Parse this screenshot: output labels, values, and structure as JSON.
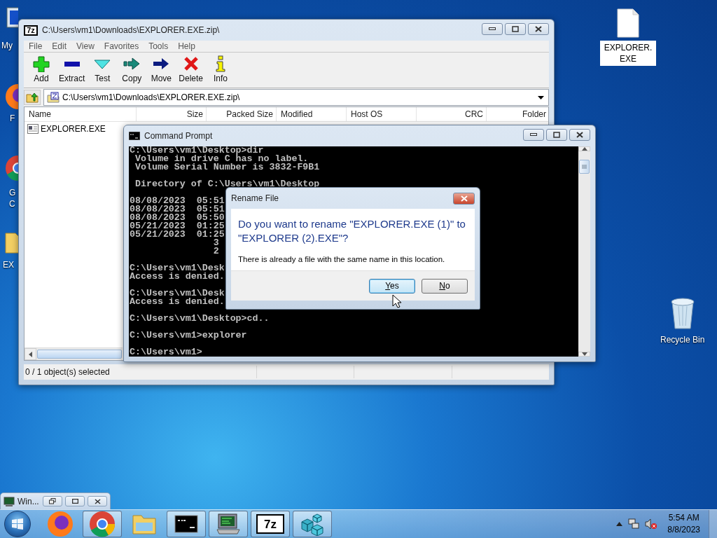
{
  "desktop": {
    "left_icons": [
      {
        "kind": "computer",
        "label_lines": [
          "My"
        ]
      },
      {
        "kind": "firefox",
        "label_lines": [
          "F"
        ]
      },
      {
        "kind": "chrome",
        "label_lines": [
          "G",
          "C"
        ]
      },
      {
        "kind": "folder",
        "label_lines": [
          "EX"
        ]
      }
    ],
    "right_icons": [
      {
        "kind": "file",
        "label": "EXPLORER.EXE",
        "selected": true
      },
      {
        "kind": "recycle-bin",
        "label": "Recycle Bin",
        "selected": false
      }
    ]
  },
  "archive_window": {
    "logo_text": "7z",
    "title": "C:\\Users\\vm1\\Downloads\\EXPLORER.EXE.zip\\",
    "menu": [
      "File",
      "Edit",
      "View",
      "Favorites",
      "Tools",
      "Help"
    ],
    "toolbar": [
      {
        "kind": "add",
        "label": "Add"
      },
      {
        "kind": "extract",
        "label": "Extract"
      },
      {
        "kind": "test",
        "label": "Test"
      },
      {
        "kind": "copy",
        "label": "Copy"
      },
      {
        "kind": "move",
        "label": "Move"
      },
      {
        "kind": "delete",
        "label": "Delete"
      },
      {
        "kind": "info",
        "label": "Info"
      }
    ],
    "address": "C:\\Users\\vm1\\Downloads\\EXPLORER.EXE.zip\\",
    "columns": [
      "Name",
      "Size",
      "Packed Size",
      "Modified",
      "Host OS",
      "CRC",
      "Folder"
    ],
    "rows": [
      {
        "name": "EXPLORER.EXE",
        "selected": false
      }
    ],
    "status_bar": "0 / 1 object(s) selected"
  },
  "command_prompt": {
    "title": "Command Prompt",
    "blocks": [
      [
        "C:\\Users\\vm1\\Desktop>dir",
        " Volume in drive C has no label.",
        " Volume Serial Number is 3832-F9B1"
      ],
      [
        " Directory of C:\\Users\\vm1\\Desktop"
      ],
      [
        "08/08/2023  05:51",
        "08/08/2023  05:51",
        "08/08/2023  05:50",
        "05/21/2023  01:25",
        "05/21/2023  01:25",
        "               3",
        "               2"
      ],
      [
        "C:\\Users\\vm1\\Desk",
        "Access is denied."
      ],
      [
        "C:\\Users\\vm1\\Desk",
        "Access is denied."
      ],
      [
        "C:\\Users\\vm1\\Desktop>cd.."
      ],
      [
        "C:\\Users\\vm1>explorer"
      ],
      [
        "C:\\Users\\vm1>"
      ]
    ]
  },
  "dialog": {
    "title": "Rename File",
    "question": "Do you want to rename \"EXPLORER.EXE (1)\" to \"EXPLORER (2).EXE\"?",
    "message": "There is already a file with the same name in this location.",
    "buttons": [
      {
        "label": "Yes",
        "selected": true
      },
      {
        "label": "No",
        "selected": false
      }
    ]
  },
  "minimized_window": {
    "title": "Win..."
  },
  "taskbar": {
    "apps": [
      {
        "kind": "firefox",
        "running": false
      },
      {
        "kind": "chrome",
        "running": true
      },
      {
        "kind": "folder",
        "running": false
      },
      {
        "kind": "cmd",
        "running": true
      },
      {
        "kind": "monitor",
        "running": true
      },
      {
        "kind": "archiver",
        "running": true,
        "logo_text": "7z"
      },
      {
        "kind": "registry",
        "running": true
      }
    ],
    "time": "5:54 AM",
    "date": "8/8/2023"
  }
}
